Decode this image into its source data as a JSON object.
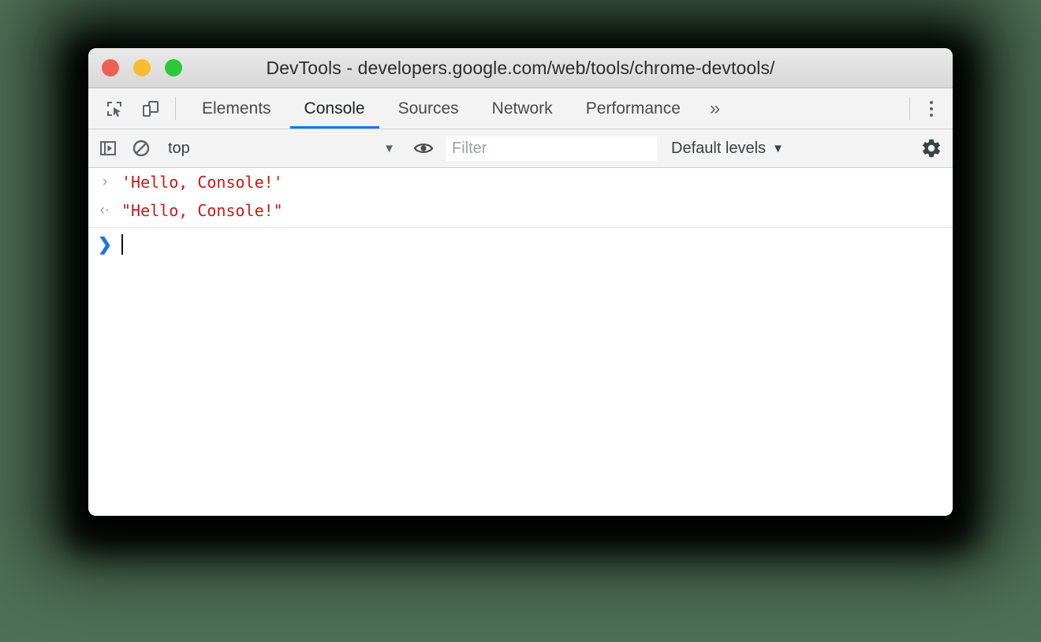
{
  "window": {
    "title": "DevTools - developers.google.com/web/tools/chrome-devtools/",
    "traffic_lights": [
      {
        "name": "close",
        "color": "#ee5f56"
      },
      {
        "name": "minimize",
        "color": "#f7bd2e"
      },
      {
        "name": "zoom",
        "color": "#2ac938"
      }
    ]
  },
  "tabbar": {
    "icons": [
      {
        "name": "inspect-element-icon"
      },
      {
        "name": "device-toolbar-icon"
      }
    ],
    "tabs": [
      {
        "label": "Elements",
        "active": false
      },
      {
        "label": "Console",
        "active": true
      },
      {
        "label": "Sources",
        "active": false
      },
      {
        "label": "Network",
        "active": false
      },
      {
        "label": "Performance",
        "active": false
      }
    ],
    "more_tabs_label": "»",
    "menu_icon": "kebab-menu-icon",
    "active_underline_color": "#1a73e8"
  },
  "console_toolbar": {
    "sidebar_toggle_icon": "console-sidebar-icon",
    "clear_icon": "clear-console-icon",
    "context": {
      "value": "top",
      "caret": "▼"
    },
    "eye_icon": "live-expression-eye-icon",
    "filter": {
      "value": "",
      "placeholder": "Filter"
    },
    "levels": {
      "label": "Default levels",
      "caret": "▼"
    },
    "settings_icon": "gear-icon"
  },
  "console": {
    "messages": [
      {
        "gutter": "›",
        "gutter_name": "input-marker",
        "text": "'Hello, Console!'",
        "color": "#c41a16"
      },
      {
        "gutter": "‹·",
        "gutter_name": "output-marker",
        "text": "\"Hello, Console!\"",
        "color": "#c41a16"
      }
    ],
    "prompt": {
      "marker": "❯",
      "marker_color": "#1a73e8",
      "input_value": ""
    }
  }
}
